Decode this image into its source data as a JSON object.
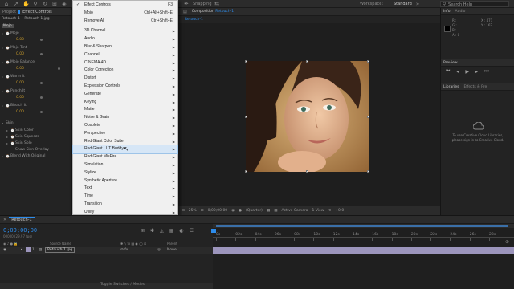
{
  "topbar": {
    "snapping_label": "Snapping",
    "workspace_label": "Workspace:",
    "workspace_value": "Standard",
    "search_placeholder": "Search Help"
  },
  "left_panel": {
    "tabs": [
      "Project",
      "Effect Controls"
    ],
    "effect_controls_title": "Retouch-1 • Retouch-1.jpg",
    "effects": [
      {
        "name": "Mojo",
        "value": ""
      },
      {
        "name": "Mojo",
        "value": "0.00"
      },
      {
        "name": "Mojo Tint",
        "value": "0.00"
      },
      {
        "name": "Mojo Balance",
        "value": "0.00"
      },
      {
        "name": "Warm It",
        "value": "0.00"
      },
      {
        "name": "Punch It",
        "value": "0.00"
      },
      {
        "name": "Bleach It",
        "value": "0.00"
      }
    ],
    "skin_group": {
      "name": "Skin",
      "children": [
        "Skin Color",
        "Skin Squeeze",
        "Skin Solo",
        "Show Skin Overlay"
      ],
      "blend_label": "Blend With Original"
    }
  },
  "menu": {
    "items": [
      {
        "label": "Effect Controls",
        "shortcut": "F3",
        "checked": true,
        "submenu": false
      },
      {
        "label": "Mojo",
        "shortcut": "Ctrl+Alt+Shift+E",
        "checked": false,
        "submenu": false
      },
      {
        "label": "Remove All",
        "shortcut": "Ctrl+Shift+E",
        "checked": false,
        "submenu": false
      },
      {
        "label": "3D Channel",
        "shortcut": "",
        "submenu": true
      },
      {
        "label": "Audio",
        "shortcut": "",
        "submenu": true
      },
      {
        "label": "Blur & Sharpen",
        "shortcut": "",
        "submenu": true
      },
      {
        "label": "Channel",
        "shortcut": "",
        "submenu": true
      },
      {
        "label": "CINEMA 4D",
        "shortcut": "",
        "submenu": true
      },
      {
        "label": "Color Correction",
        "shortcut": "",
        "submenu": true
      },
      {
        "label": "Distort",
        "shortcut": "",
        "submenu": true
      },
      {
        "label": "Expression Controls",
        "shortcut": "",
        "submenu": true
      },
      {
        "label": "Generate",
        "shortcut": "",
        "submenu": true
      },
      {
        "label": "Keying",
        "shortcut": "",
        "submenu": true
      },
      {
        "label": "Matte",
        "shortcut": "",
        "submenu": true
      },
      {
        "label": "Noise & Grain",
        "shortcut": "",
        "submenu": true
      },
      {
        "label": "Obsolete",
        "shortcut": "",
        "submenu": true
      },
      {
        "label": "Perspective",
        "shortcut": "",
        "submenu": true
      },
      {
        "label": "Red Giant Color Suite",
        "shortcut": "",
        "submenu": true
      },
      {
        "label": "Red Giant LUT Buddy",
        "shortcut": "",
        "submenu": true,
        "highlighted": true
      },
      {
        "label": "Red Giant MisFire",
        "shortcut": "",
        "submenu": true
      },
      {
        "label": "Simulation",
        "shortcut": "",
        "submenu": true
      },
      {
        "label": "Stylize",
        "shortcut": "",
        "submenu": true
      },
      {
        "label": "Synthetic Aperture",
        "shortcut": "",
        "submenu": true
      },
      {
        "label": "Text",
        "shortcut": "",
        "submenu": true
      },
      {
        "label": "Time",
        "shortcut": "",
        "submenu": true
      },
      {
        "label": "Transition",
        "shortcut": "",
        "submenu": true
      },
      {
        "label": "Utility",
        "shortcut": "",
        "submenu": true
      }
    ]
  },
  "composition": {
    "tab_label": "Composition",
    "comp_name": "Retouch-1",
    "sub_tab": "Retouch-1",
    "zoom": "25%",
    "timecode": "0;00;00;00",
    "resolution": "(Quarter)",
    "camera": "Active Camera",
    "views": "1 View",
    "offset": "+0.0"
  },
  "info_panel": {
    "tabs": [
      "Info",
      "Audio"
    ],
    "r_label": "R :",
    "g_label": "G :",
    "b_label": "B :",
    "a_label": "A : 0",
    "x_label": "X : 471",
    "y_label": "Y : 162"
  },
  "preview_panel": {
    "tab": "Preview"
  },
  "libraries_panel": {
    "tabs": [
      "Libraries",
      "Effects & Pre"
    ],
    "message_line1": "To use Creative Cloud Libraries,",
    "message_line2": "please sign in to Creative Cloud."
  },
  "timeline": {
    "tab": "Retouch-1",
    "timecode": "0;00;00;00",
    "frame_info": "00000 (29.97 fps)",
    "source_header": "Source Name",
    "parent_header": "Parent",
    "layer_number": "1",
    "layer_name": "Retouch-1.jpg",
    "parent_value": "None",
    "toggle_label": "Toggle Switches / Modes",
    "ruler_labels": [
      "0s",
      "02s",
      "04s",
      "06s",
      "08s",
      "10s",
      "12s",
      "14s",
      "16s",
      "18s",
      "20s",
      "22s",
      "24s",
      "26s",
      "28s"
    ]
  },
  "colors": {
    "bg": "#232323",
    "panel_header": "#2b2b2b",
    "accent_blue": "#2d8ceb",
    "value_orange": "#c79a2a",
    "menu_bg": "#f0f0f0",
    "layer_bar": "#9c95bc",
    "work_area": "#3a6fa8"
  }
}
